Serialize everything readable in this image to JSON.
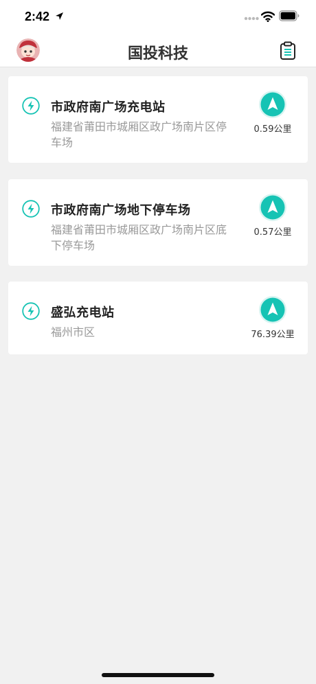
{
  "status_bar": {
    "time": "2:42"
  },
  "header": {
    "title": "国投科技"
  },
  "stations": [
    {
      "name": "市政府南广场充电站",
      "address": "福建省莆田市城厢区政广场南片区停车场",
      "distance": "0.59公里"
    },
    {
      "name": "市政府南广场地下停车场",
      "address": "福建省莆田市城厢区政广场南片区底下停车场",
      "distance": "0.57公里"
    },
    {
      "name": "盛弘充电站",
      "address": "福州市区",
      "distance": "76.39公里"
    }
  ],
  "colors": {
    "accent": "#16c3b4",
    "background": "#f1f1f1",
    "card": "#ffffff",
    "address_text": "#999999"
  },
  "icons": {
    "avatar": "avatar",
    "clipboard": "clipboard-icon",
    "station": "lightning-bolt-icon",
    "navigate": "navigation-arrow-icon"
  }
}
